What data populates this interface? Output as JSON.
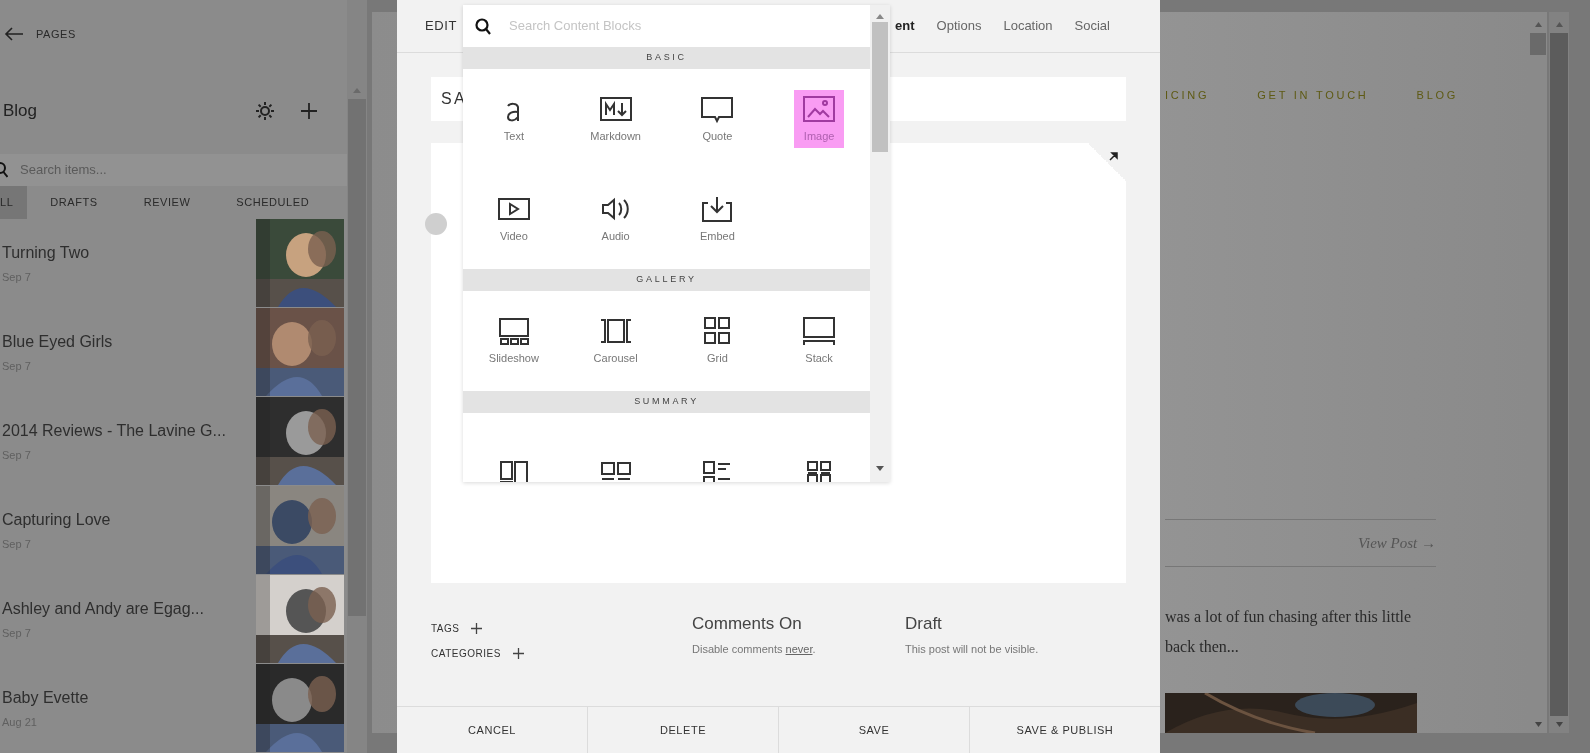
{
  "sidebar": {
    "back_label": "PAGES",
    "title": "Blog",
    "search": {
      "placeholder": "Search items..."
    },
    "tabs": [
      {
        "label": "LL",
        "selected": true
      },
      {
        "label": "DRAFTS",
        "selected": false
      },
      {
        "label": "REVIEW",
        "selected": false
      },
      {
        "label": "SCHEDULED",
        "selected": false
      }
    ],
    "items": [
      {
        "title": "Turning Two",
        "date": "Sep 7"
      },
      {
        "title": "Blue Eyed Girls",
        "date": "Sep 7"
      },
      {
        "title": "2014 Reviews - The Lavine G...",
        "date": "Sep 7"
      },
      {
        "title": "Capturing Love",
        "date": "Sep 7"
      },
      {
        "title": "Ashley and Andy are Egag...",
        "date": "Sep 7"
      },
      {
        "title": "Baby Evette",
        "date": "Aug 21"
      }
    ]
  },
  "modal": {
    "heading": "EDIT",
    "tabs": [
      {
        "label": "ent",
        "selected": true
      },
      {
        "label": "Options",
        "selected": false
      },
      {
        "label": "Location",
        "selected": false
      },
      {
        "label": "Social",
        "selected": false
      }
    ],
    "title_value": "SA",
    "meta": {
      "tags_label": "TAGS",
      "categories_label": "CATEGORIES",
      "comments": {
        "title": "Comments On",
        "text": "Disable comments ",
        "link": "never",
        "suffix": "."
      },
      "status": {
        "title": "Draft",
        "text": "This post will not be visible."
      }
    },
    "buttons": [
      "CANCEL",
      "DELETE",
      "SAVE",
      "SAVE & PUBLISH"
    ]
  },
  "block_picker": {
    "search": {
      "placeholder": "Search Content Blocks"
    },
    "sections": [
      {
        "title": "BASIC",
        "blocks": [
          {
            "label": "Text",
            "selected": false
          },
          {
            "label": "Markdown",
            "selected": false
          },
          {
            "label": "Quote",
            "selected": false
          },
          {
            "label": "Image",
            "selected": true
          },
          {
            "label": "Video",
            "selected": false
          },
          {
            "label": "Audio",
            "selected": false
          },
          {
            "label": "Embed",
            "selected": false
          }
        ]
      },
      {
        "title": "GALLERY",
        "blocks": [
          {
            "label": "Slideshow",
            "selected": false
          },
          {
            "label": "Carousel",
            "selected": false
          },
          {
            "label": "Grid",
            "selected": false
          },
          {
            "label": "Stack",
            "selected": false
          }
        ]
      },
      {
        "title": "SUMMARY",
        "blocks": [
          {
            "selected": false
          },
          {
            "selected": false
          },
          {
            "selected": false
          },
          {
            "selected": false
          }
        ]
      }
    ]
  },
  "site": {
    "nav": [
      "ICING",
      "GET IN TOUCH",
      "BLOG"
    ],
    "view_post": "View Post →",
    "excerpt_lines": [
      "was a lot of fun chasing after this little",
      "back then..."
    ]
  }
}
